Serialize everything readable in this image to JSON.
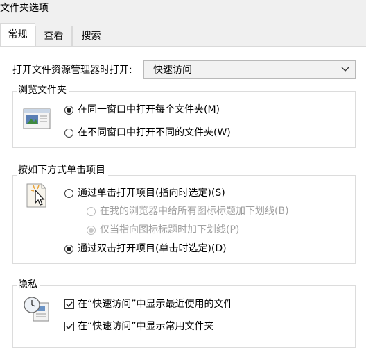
{
  "window": {
    "title": "文件夹选项"
  },
  "tabs": [
    {
      "label": "常规",
      "active": true
    },
    {
      "label": "查看",
      "active": false
    },
    {
      "label": "搜索",
      "active": false
    }
  ],
  "open_explorer": {
    "label": "打开文件资源管理器时打开:",
    "selected": "快速访问"
  },
  "browse_folders": {
    "title": "浏览文件夹",
    "options": [
      {
        "label": "在同一窗口中打开每个文件夹(M)",
        "checked": true
      },
      {
        "label": "在不同窗口中打开不同的文件夹(W)",
        "checked": false
      }
    ]
  },
  "click_items": {
    "title": "按如下方式单击项目",
    "single_click": {
      "label": "通过单击打开项目(指向时选定)(S)",
      "checked": false
    },
    "underline_all": {
      "label": "在我的浏览器中给所有图标标题加下划线(B)",
      "checked": false,
      "disabled": true
    },
    "underline_hover": {
      "label": "仅当指向图标标题时加下划线(P)",
      "checked": true,
      "disabled": true
    },
    "double_click": {
      "label": "通过双击打开项目(单击时选定)(D)",
      "checked": true
    }
  },
  "privacy": {
    "title": "隐私",
    "options": [
      {
        "label": "在“快速访问”中显示最近使用的文件",
        "checked": true
      },
      {
        "label": "在“快速访问”中显示常用文件夹",
        "checked": true
      }
    ]
  },
  "icons": {
    "browse": "folder-window-icon",
    "click": "cursor-click-icon",
    "privacy": "clock-document-icon",
    "dropdown": "chevron-down-icon",
    "checkmark": "checkmark-icon"
  },
  "colors": {
    "dialog_background": "#f0f0f0",
    "panel_background": "#ffffff",
    "border": "#dcdcdc",
    "disabled_text": "#a0a0a0",
    "dropdown_background": "#f2f2f2"
  }
}
